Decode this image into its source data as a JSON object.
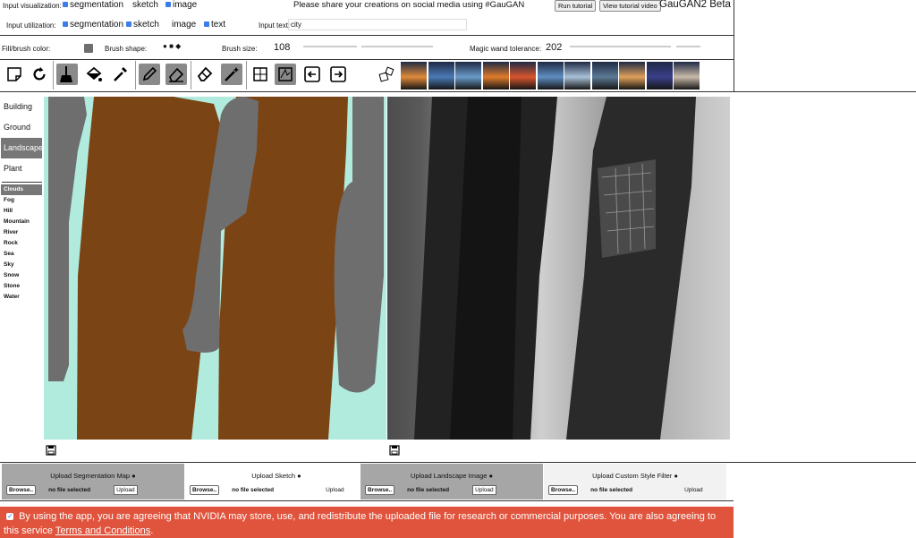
{
  "header": {
    "input_vis_label": "Input visualization:",
    "vis_options": [
      "segmentation",
      "sketch",
      "image"
    ],
    "input_util_label": "Input utilization:",
    "util_options": [
      "segmentation",
      "sketch",
      "image",
      "text"
    ],
    "share_text": "Please share your creations on social media using #GauGAN",
    "run_tutorial": "Run tutorial",
    "view_video": "View tutorial video",
    "title": "GauGAN2 Beta",
    "input_text_label": "Input text:",
    "input_text_value": "city"
  },
  "brush": {
    "fill_label": "Fill/brush color:",
    "shape_label": "Brush shape:",
    "size_label": "Brush size:",
    "size_value": "108",
    "wand_label": "Magic wand tolerance:",
    "wand_value": "202"
  },
  "thumbnails": [
    "#e08a3a",
    "#4a7ab5",
    "#6a9bc9",
    "#e07b2a",
    "#d9552e",
    "#5f8ec0",
    "#a9c1d8",
    "#5c7993",
    "#e0a05a",
    "#3a3f8a",
    "#c9b9a9"
  ],
  "categories": [
    "Building",
    "Ground",
    "Landscape",
    "Plant"
  ],
  "subcategories": [
    "Clouds",
    "Fog",
    "Hill",
    "Mountain",
    "River",
    "Rock",
    "Sea",
    "Sky",
    "Snow",
    "Stone",
    "Water"
  ],
  "uploads": [
    {
      "title": "Upload Segmentation Map",
      "browse": "Browse..",
      "file": "no file selected",
      "upload": "Upload"
    },
    {
      "title": "Upload Sketch",
      "browse": "Browse..",
      "file": "no file selected",
      "upload": "Upload"
    },
    {
      "title": "Upload Landscape Image",
      "browse": "Browse..",
      "file": "no file selected",
      "upload": "Upload"
    },
    {
      "title": "Upload Custom Style Filter",
      "browse": "Browse..",
      "file": "no file selected",
      "upload": "Upload"
    }
  ],
  "consent": {
    "text": "By using the app, you are agreeing that NVIDIA may store, use, and redistribute the uploaded file for research or commercial purposes. You are also agreeing to this service ",
    "link": "Terms and Conditions",
    "end": "."
  },
  "colors": {
    "canvas_bg": "#b1ebde",
    "tree": "#7b4414",
    "gray_stroke": "#6e6e6e",
    "consent_bg": "#e0533c"
  }
}
